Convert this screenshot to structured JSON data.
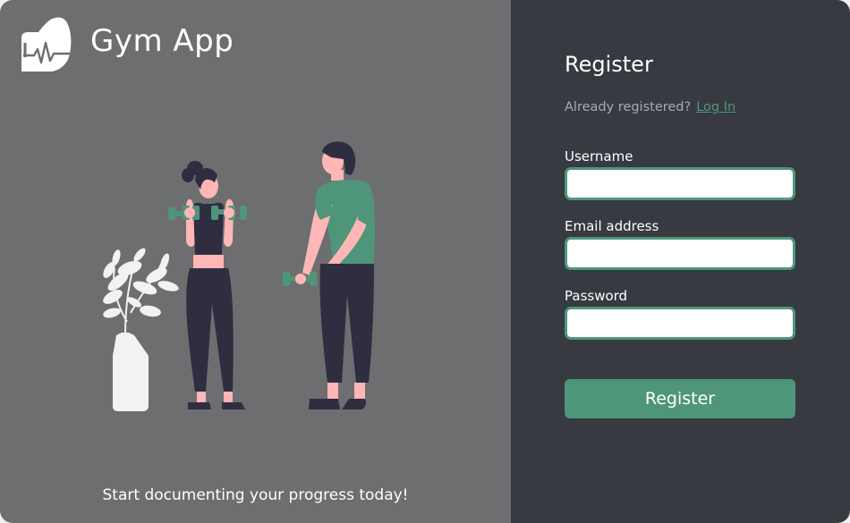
{
  "brand": {
    "name": "Gym App",
    "logo_icon": "flexed-arm-heartbeat-icon"
  },
  "hero": {
    "tagline": "Start documenting your progress today!",
    "illustration": "two-people-lifting-dumbbells-with-plant"
  },
  "form": {
    "title": "Register",
    "login_prompt": "Already registered?",
    "login_link": "Log In",
    "fields": [
      {
        "label": "Username",
        "value": "",
        "placeholder": ""
      },
      {
        "label": "Email address",
        "value": "",
        "placeholder": ""
      },
      {
        "label": "Password",
        "value": "",
        "placeholder": ""
      }
    ],
    "submit_label": "Register"
  },
  "colors": {
    "left_panel": "#6d6e70",
    "right_panel": "#373a41",
    "accent": "#4f957a",
    "muted_text": "#a9abad"
  }
}
